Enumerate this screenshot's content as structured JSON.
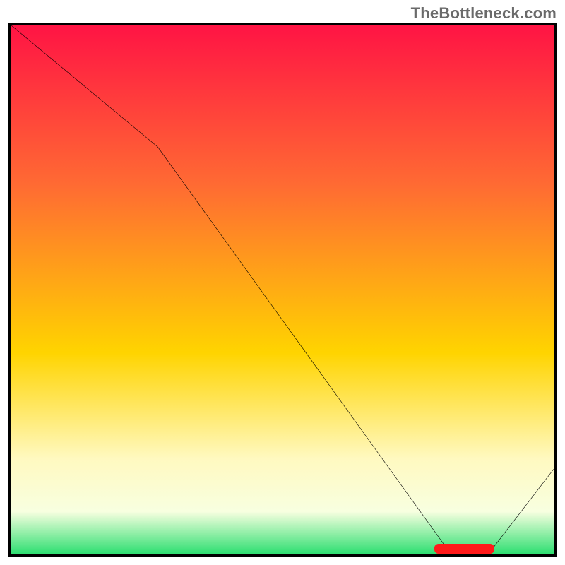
{
  "attribution": "TheBottleneck.com",
  "colors": {
    "gradient_top": "#ff1444",
    "gradient_mid_upper": "#ff6a33",
    "gradient_mid": "#ffd400",
    "gradient_mid_lower": "#fff9c0",
    "gradient_low": "#f8ffe0",
    "gradient_bottom": "#2fdf72",
    "line": "#000000",
    "marker": "#ff1a1a",
    "border": "#000000"
  },
  "chart_data": {
    "type": "line",
    "title": "",
    "xlabel": "",
    "ylabel": "",
    "xlim": [
      0,
      100
    ],
    "ylim": [
      0,
      100
    ],
    "x": [
      0,
      27,
      81,
      88,
      100
    ],
    "values": [
      100,
      77,
      0,
      0,
      16
    ],
    "marker": {
      "x_start": 78,
      "x_end": 89,
      "y": 0
    },
    "grid": false,
    "legend": null
  }
}
